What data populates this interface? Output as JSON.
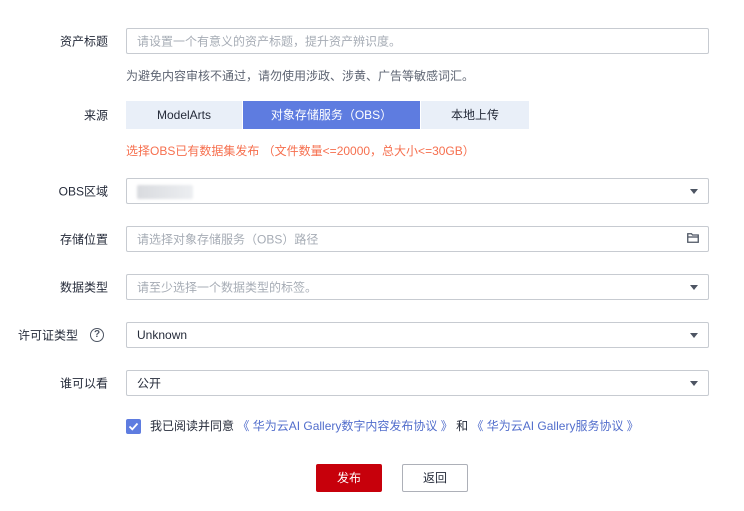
{
  "form": {
    "asset_title": {
      "label": "资产标题",
      "placeholder": "请设置一个有意义的资产标题，提升资产辨识度。",
      "hint": "为避免内容审核不通过，请勿使用涉政、涉黄、广告等敏感词汇。"
    },
    "source": {
      "label": "来源",
      "options": [
        "ModelArts",
        "对象存储服务（OBS）",
        "本地上传"
      ],
      "selected": "对象存储服务（OBS）",
      "warning": "选择OBS已有数据集发布 （文件数量<=20000，总大小<=30GB）"
    },
    "obs_region": {
      "label": "OBS区域"
    },
    "storage_location": {
      "label": "存储位置",
      "placeholder": "请选择对象存储服务（OBS）路径"
    },
    "data_type": {
      "label": "数据类型",
      "placeholder": "请至少选择一个数据类型的标签。"
    },
    "license_type": {
      "label": "许可证类型",
      "help": "?",
      "value": "Unknown"
    },
    "visibility": {
      "label": "谁可以看",
      "value": "公开"
    },
    "agreement": {
      "checked": true,
      "prefix": "我已阅读并同意",
      "link1": "《 华为云AI Gallery数字内容发布协议 》",
      "and": "和",
      "link2": "《 华为云AI Gallery服务协议 》"
    }
  },
  "actions": {
    "publish_label": "发布",
    "back_label": "返回"
  },
  "colors": {
    "accent": "#5e7ce0",
    "primary_button": "#c7000b",
    "warning_text": "#f66f4e",
    "link": "#526ecc"
  }
}
